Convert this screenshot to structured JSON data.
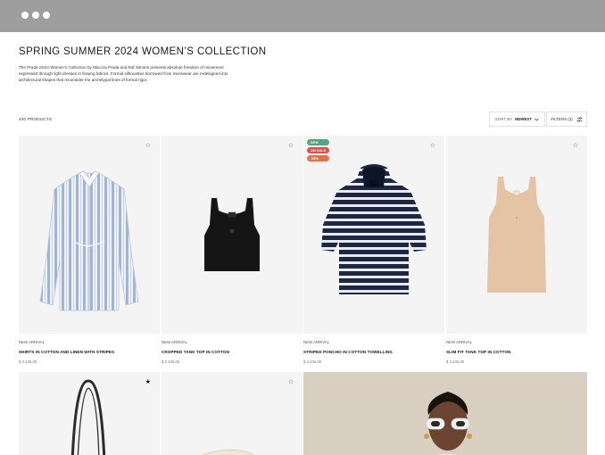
{
  "window": {
    "controls": [
      "dot",
      "dot",
      "dot"
    ]
  },
  "header": {
    "title": "SPRING SUMMER 2024 WOMEN’S COLLECTION",
    "description": "The Prada SS24 Women’s Collection by Miuccia Prada and Raf Simons presents absolute freedom of movement expressed through light dresses in flowing fabrics. Formal silhouettes borrowed from menswear are redesigned into architectural shapes that reconsider the archetypal lines of formal rigor."
  },
  "toolbar": {
    "count": "430 PRODUCTS",
    "sort_label": "SORT BY",
    "sort_value": "NEWEST",
    "filters_label": "FILTERS (3)"
  },
  "products": [
    {
      "tag": "NEW ARRIVAL",
      "name": "SHIRTS IN COTTON AND LINEN WITH STRIPES",
      "price": "$ 3.335,00",
      "favorited": false,
      "badges": []
    },
    {
      "tag": "NEW ARRIVAL",
      "name": "CROPPED TANK TOP IN COTTON",
      "price": "$ 3.335,00",
      "favorited": false,
      "badges": []
    },
    {
      "tag": "NEW ARRIVAL",
      "name": "STRIPED PONCHO IN COTTON TOWELLING",
      "price": "$ 3.335,00",
      "favorited": false,
      "badges": [
        {
          "label": "NEW",
          "color": "#5aa27c"
        },
        {
          "label": "ON SALE",
          "color": "#d9544d"
        },
        {
          "label": "-50%",
          "color": "#e0734d"
        }
      ]
    },
    {
      "tag": "NEW ARRIVAL",
      "name": "SLIM FIT TANK TOP IN COTTON",
      "price": "$ 3.335,00",
      "favorited": false,
      "badges": []
    }
  ],
  "second_row": [
    {
      "favorited": true
    },
    {
      "favorited": false
    }
  ],
  "colors": {
    "frame": "#9e9e9e",
    "image_bg": "#f4f4f4",
    "promo_bg": "#d8cfc1"
  }
}
